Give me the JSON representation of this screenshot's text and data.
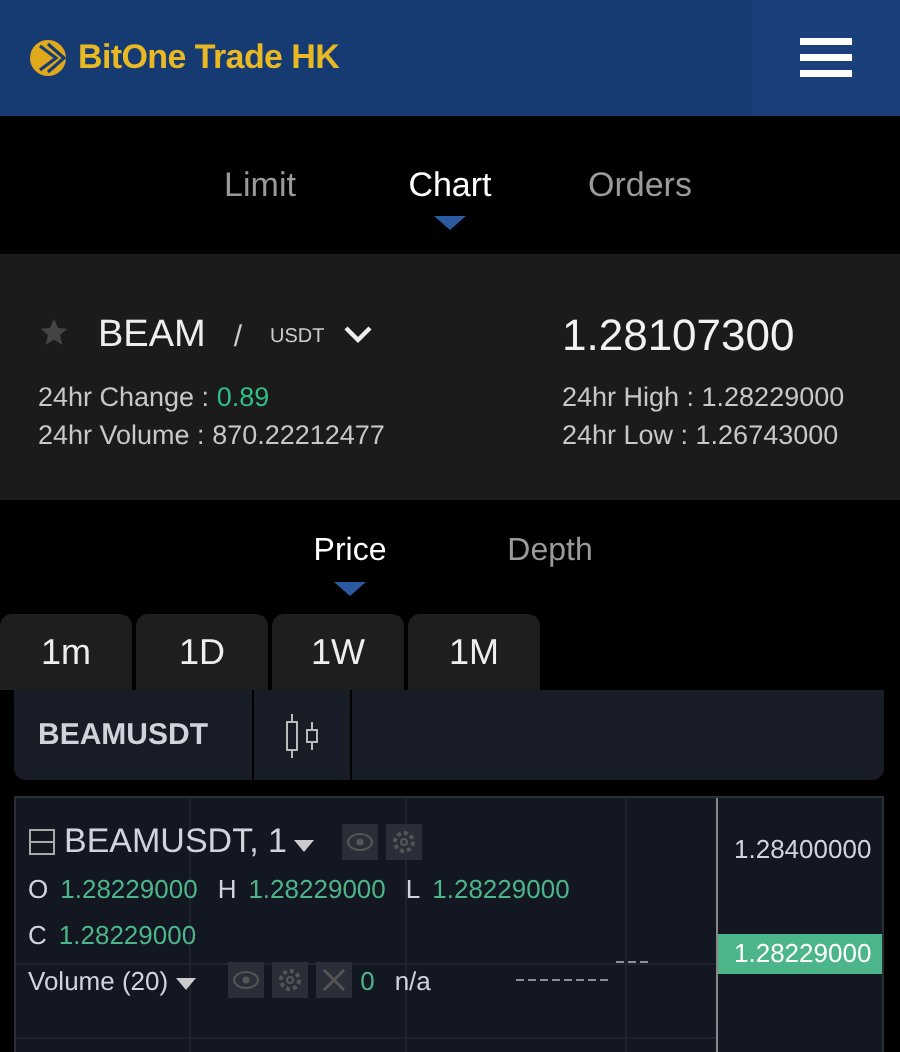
{
  "header": {
    "logo_text": "BitOne Trade HK"
  },
  "tabs": [
    {
      "label": "Limit",
      "selected": false
    },
    {
      "label": "Chart",
      "selected": true
    },
    {
      "label": "Orders",
      "selected": false
    }
  ],
  "ticker": {
    "favorite": false,
    "base": "BEAM",
    "separator": "/",
    "quote": "USDT",
    "price": "1.28107300",
    "stats_left": [
      {
        "label": "24hr Change : ",
        "value": "0.89",
        "positive": true
      },
      {
        "label": "24hr Volume : ",
        "value": "870.22212477",
        "positive": false
      }
    ],
    "stats_right": [
      {
        "label": "24hr High : ",
        "value": "1.28229000"
      },
      {
        "label": "24hr Low : ",
        "value": "1.26743000"
      }
    ]
  },
  "chart_tabs": [
    {
      "label": "Price",
      "selected": true
    },
    {
      "label": "Depth",
      "selected": false
    }
  ],
  "intervals": [
    {
      "label": "1m",
      "selected": false
    },
    {
      "label": "1D",
      "selected": false
    },
    {
      "label": "1W",
      "selected": false
    },
    {
      "label": "1M",
      "selected": false
    }
  ],
  "toolbar": {
    "symbol": "BEAMUSDT"
  },
  "chart": {
    "title": "BEAMUSDT, 1",
    "ohlc": [
      {
        "key": "O",
        "value": "1.28229000"
      },
      {
        "key": "H",
        "value": "1.28229000"
      },
      {
        "key": "L",
        "value": "1.28229000"
      },
      {
        "key": "C",
        "value": "1.28229000"
      }
    ],
    "volume_label": "Volume (20)",
    "volume_value": "0",
    "volume_extra": "n/a",
    "axis_labels": [
      {
        "text": "1.28400000",
        "current": false
      },
      {
        "text": "1.28229000",
        "current": true
      }
    ]
  }
}
